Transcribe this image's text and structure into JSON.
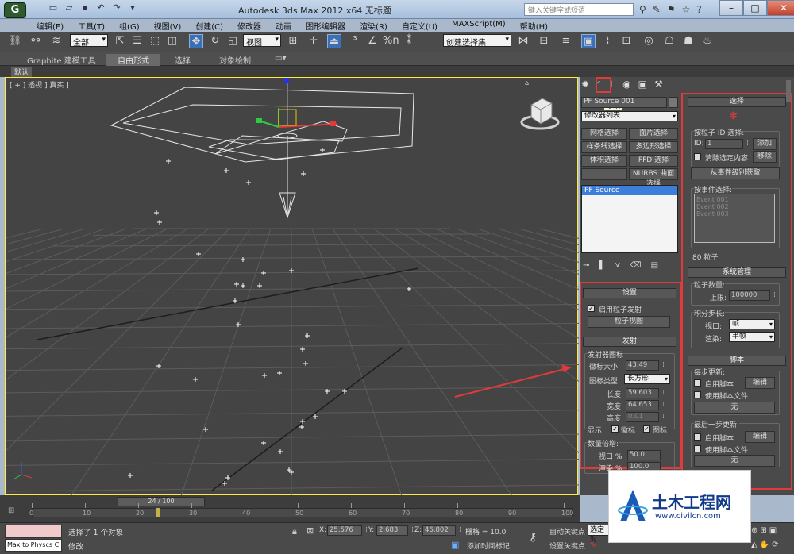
{
  "window": {
    "title": "Autodesk 3ds Max  2012 x64        无标题",
    "search_placeholder": "键入关键字或短语",
    "app_icon": "3ds-max-logo"
  },
  "menu": [
    "编辑(E)",
    "工具(T)",
    "组(G)",
    "视图(V)",
    "创建(C)",
    "修改器",
    "动画",
    "图形编辑器",
    "渲染(R)",
    "自定义(U)",
    "MAXScript(M)",
    "帮助(H)"
  ],
  "toolbar": {
    "selection_filter": "全部",
    "ref_coord": "视图",
    "named_selection": "创建选择集",
    "snap_percent": "%n"
  },
  "ribbon": {
    "tabs": [
      "Graphite 建模工具",
      "自由形式",
      "选择",
      "对象绘制"
    ],
    "active_tab": "自由形式",
    "sub_label": "默认"
  },
  "viewport": {
    "label": "[ + ] 透视 ] 真实 ]",
    "cube_label": "前"
  },
  "command_panel": {
    "tooltip": "修改",
    "object_name": "PF Source 001",
    "modifier_list": "修改器列表",
    "modifier_buttons": [
      "网格选择",
      "面片选择",
      "样条线选择",
      "多边形选择",
      "体积选择",
      "FFD 选择",
      "",
      "NURBS 曲面选择"
    ],
    "stack_item": "PF Source",
    "setup": {
      "title": "设置",
      "enable_emission": "启用粒子发射",
      "particle_view": "粒子视图"
    },
    "emission": {
      "title": "发射",
      "icon_group": "发射器图标",
      "logo_size_label": "徽标大小:",
      "logo_size": "43.49",
      "icon_type_label": "图标类型:",
      "icon_type": "长方形",
      "length_label": "长度:",
      "length": "59.603",
      "width_label": "宽度:",
      "width": "64.653",
      "height_label": "高度:",
      "height": "0.01",
      "display_label": "显示:",
      "display_logo": "徽标",
      "display_icon": "图标",
      "quantity_group": "数量倍增:",
      "viewport_pct_label": "视口 %",
      "viewport_pct": "50.0",
      "render_pct_label": "渲染 %",
      "render_pct": "100.0"
    }
  },
  "right_panel": {
    "selection": {
      "title": "选择",
      "by_id_group": "按粒子 ID 选择:",
      "id_label": "ID:",
      "id_value": "1",
      "add": "添加",
      "clear_selected": "清除选定内容",
      "remove": "移除",
      "get_from_event": "从事件级别获取",
      "by_event_group": "按事件选择:",
      "events": [
        "Event 001",
        "Event 002",
        "Event 003"
      ],
      "particle_count": "80 粒子"
    },
    "system": {
      "title": "系统管理",
      "particle_qty_group": "粒子数量:",
      "limit_label": "上限:",
      "limit": "100000",
      "integration_group": "积分步长:",
      "viewport_label": "视口:",
      "viewport_value": "帧",
      "render_label": "渲染:",
      "render_value": "半帧"
    },
    "script": {
      "title": "脚本",
      "every_step_group": "每步更新:",
      "enable_script_1": "启用脚本",
      "edit_1": "编辑",
      "use_script_file_1": "使用脚本文件",
      "none_1": "无",
      "final_step_group": "最后一步更新:",
      "enable_script_2": "启用脚本",
      "edit_2": "编辑",
      "use_script_file_2": "使用脚本文件",
      "none_2": "无"
    }
  },
  "timeline": {
    "frame": "24 / 100",
    "ticks": [
      "0",
      "10",
      "20",
      "30",
      "40",
      "50",
      "60",
      "70",
      "80",
      "90",
      "100"
    ]
  },
  "status": {
    "script_listener": "Max to Physcs C",
    "selection_msg": "选择了 1 个对象",
    "prompt": "修改",
    "x_label": "X:",
    "x": "25.576",
    "y_label": "Y:",
    "y": "2.683",
    "z_label": "Z:",
    "z": "46.802",
    "grid": "栅格 = 10.0",
    "add_time_tag": "添加时间标记",
    "auto_key": "自动关键点",
    "set_key": "设置关键点",
    "key_filter": "选定对",
    "watermark": "土木工程网",
    "watermark_url": "www.civilcn.com"
  }
}
